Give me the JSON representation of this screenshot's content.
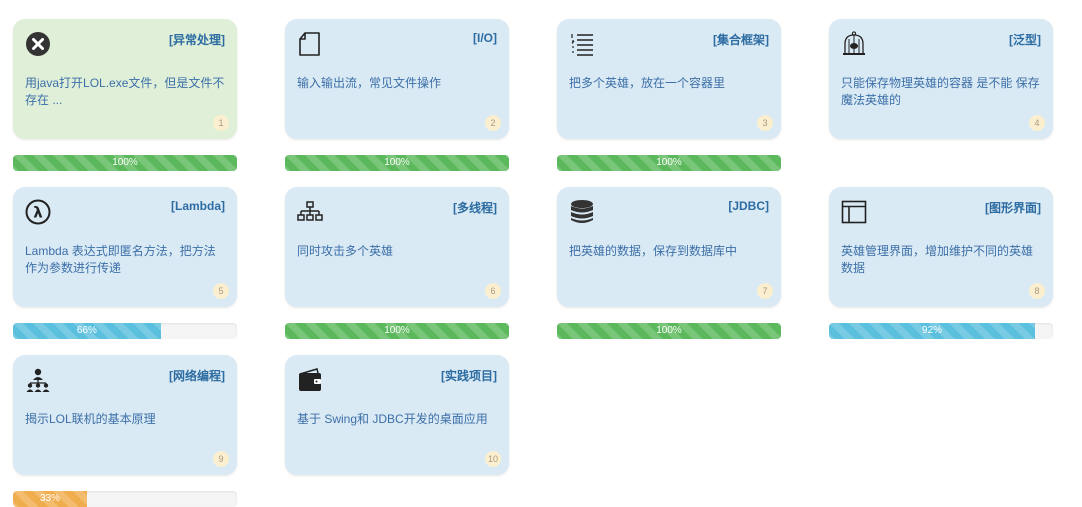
{
  "colors": {
    "card_background": "#daeaf4",
    "card_background_completed": "#e0f0d8",
    "title_color": "#2d6ca2",
    "success": "#5cb85c",
    "info": "#5bc0de",
    "warning": "#f0ad4e"
  },
  "courses": [
    {
      "title": "[异常处理]",
      "desc": "用java打开LOL.exe文件，但是文件不存在 ...",
      "num": "1",
      "icon": "close-circle-icon",
      "progress": {
        "label": "100%",
        "value": 100,
        "style": "success"
      },
      "card_style": "green"
    },
    {
      "title": "[I/O]",
      "desc": "输入输出流，常见文件操作",
      "num": "2",
      "icon": "document-icon",
      "progress": {
        "label": "100%",
        "value": 100,
        "style": "success"
      },
      "card_style": "blue"
    },
    {
      "title": "[集合框架]",
      "desc": "把多个英雄，放在一个容器里",
      "num": "3",
      "icon": "list-icon",
      "progress": {
        "label": "100%",
        "value": 100,
        "style": "success"
      },
      "card_style": "blue"
    },
    {
      "title": "[泛型]",
      "desc": "只能保存物理英雄的容器 是不能 保存魔法英雄的",
      "num": "4",
      "icon": "birdcage-icon",
      "progress": null,
      "card_style": "blue"
    },
    {
      "title": "[Lambda]",
      "desc": "Lambda 表达式即匿名方法，把方法作为参数进行传递",
      "num": "5",
      "icon": "lambda-icon",
      "progress": {
        "label": "66%",
        "value": 66,
        "style": "info"
      },
      "card_style": "blue"
    },
    {
      "title": "[多线程]",
      "desc": "同时攻击多个英雄",
      "num": "6",
      "icon": "network-tree-icon",
      "progress": {
        "label": "100%",
        "value": 100,
        "style": "success"
      },
      "card_style": "blue"
    },
    {
      "title": "[JDBC]",
      "desc": "把英雄的数据，保存到数据库中",
      "num": "7",
      "icon": "database-icon",
      "progress": {
        "label": "100%",
        "value": 100,
        "style": "success"
      },
      "card_style": "blue"
    },
    {
      "title": "[图形界面]",
      "desc": "英雄管理界面，增加维护不同的英雄数据",
      "num": "8",
      "icon": "window-layout-icon",
      "progress": {
        "label": "92%",
        "value": 92,
        "style": "info"
      },
      "card_style": "blue"
    },
    {
      "title": "[网络编程]",
      "desc": "揭示LOL联机的基本原理",
      "num": "9",
      "icon": "users-network-icon",
      "progress": {
        "label": "33%",
        "value": 33,
        "style": "warning"
      },
      "card_style": "blue"
    },
    {
      "title": "[实践项目]",
      "desc": "基于 Swing和 JDBC开发的桌面应用",
      "num": "10",
      "icon": "wallet-icon",
      "progress": null,
      "card_style": "blue"
    }
  ]
}
